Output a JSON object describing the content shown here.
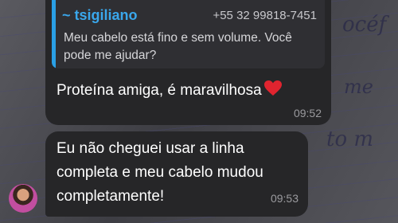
{
  "reply": {
    "sender_name": "~ tsigiliano",
    "sender_phone": "+55 32 99818-7451",
    "quoted_text": "Meu cabelo está fino e sem volume. Você pode me ajudar?"
  },
  "messages": [
    {
      "text": "Proteína amiga, é maravilhosa",
      "time": "09:52",
      "emoji": "heart-emoji"
    },
    {
      "text": "Eu não cheguei usar a linha completa e meu cabelo mudou completamente!",
      "time": "09:53"
    }
  ],
  "background_scribbles": [
    "océf",
    "me",
    "to m"
  ],
  "colors": {
    "bubble": "#262628",
    "accent": "#2aa0e6",
    "heart": "#e0242f"
  }
}
